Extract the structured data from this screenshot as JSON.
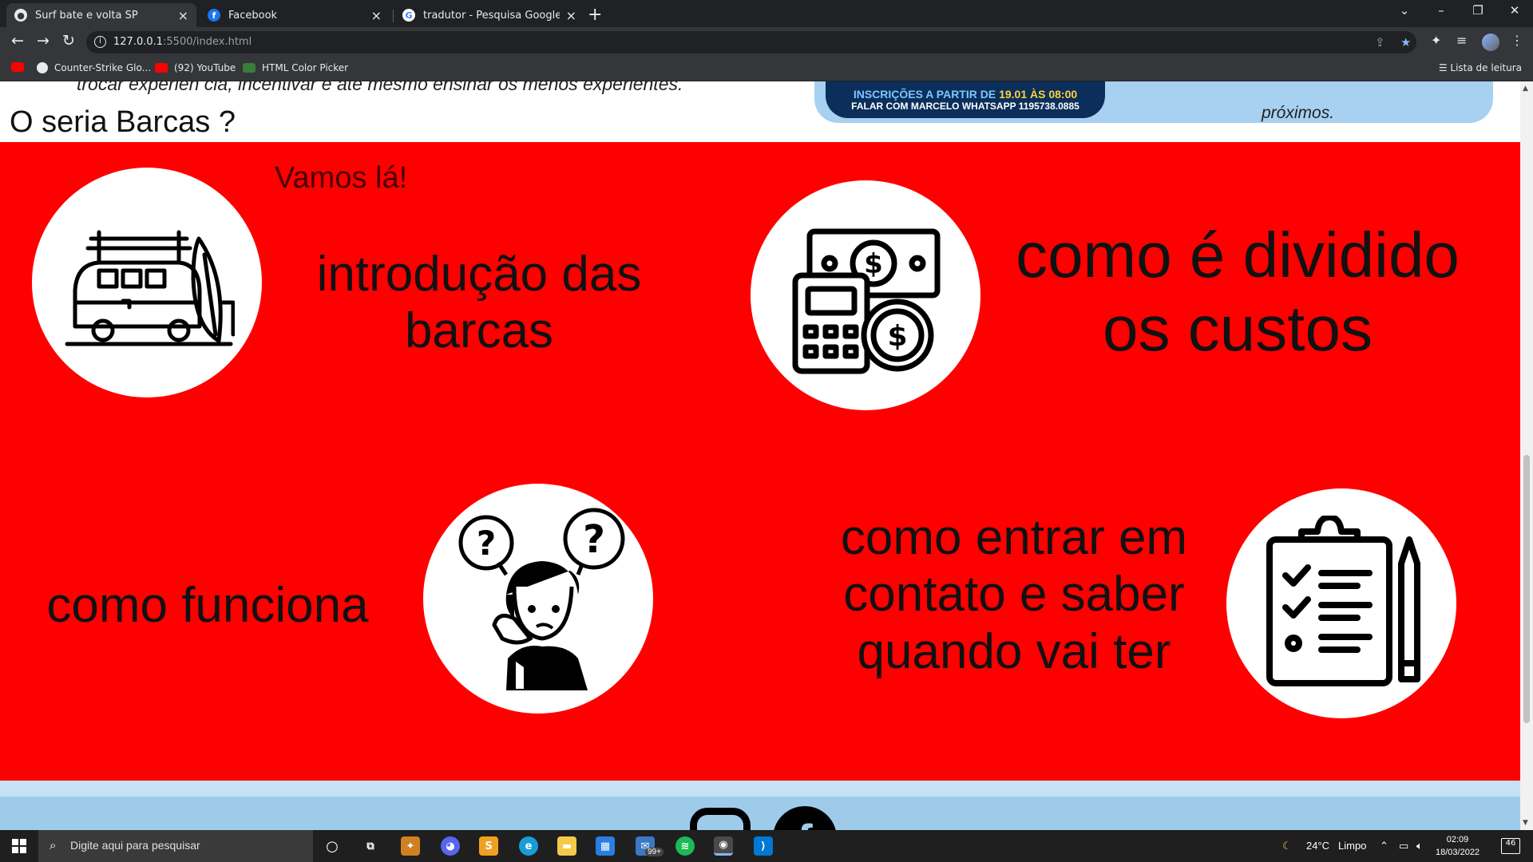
{
  "browser": {
    "tabs": [
      {
        "title": "Surf bate e volta SP",
        "active": true,
        "favicon": "globe-icon"
      },
      {
        "title": "Facebook",
        "active": false,
        "favicon": "facebook-icon"
      },
      {
        "title": "tradutor - Pesquisa Google",
        "active": false,
        "favicon": "google-icon"
      }
    ],
    "url_host": "127.0.0.1",
    "url_rest": ":5500/index.html",
    "bookmarks": [
      {
        "label": "",
        "icon": "youtube-icon"
      },
      {
        "label": "Counter-Strike Glo...",
        "icon": "steam-icon"
      },
      {
        "label": "(92) YouTube",
        "icon": "youtube-icon"
      },
      {
        "label": "HTML Color Picker",
        "icon": "color-picker-icon"
      }
    ],
    "reading_list": "Lista de leitura"
  },
  "page": {
    "prev_text": "trocar experiên cia, incentivar e até mesmo ensinar os menos experientes.",
    "poster": {
      "line1_a": "INSCRIÇÕES A PARTIR DE ",
      "line1_b": "19.01 ÀS 08:00",
      "line2": "FALAR COM MARCELO WHATSAPP 1195738.0885",
      "side_text": "próximos."
    },
    "section_title": "O seria Barcas ?",
    "vamos": "Vamos lá!",
    "cards": [
      {
        "text_lines": [
          "introdução das",
          "barcas"
        ],
        "icon": "van-surfboard-icon"
      },
      {
        "text_lines": [
          "como é dividido",
          "os custos"
        ],
        "icon": "money-calculator-icon"
      },
      {
        "text_lines": [
          "como funciona"
        ],
        "icon": "confused-person-icon"
      },
      {
        "text_lines": [
          "como entrar em",
          "contato e saber",
          "quando vai ter"
        ],
        "icon": "clipboard-checklist-icon"
      }
    ],
    "colors": {
      "section_bg": "#ff0000",
      "footer_bg": "#9ecbea"
    }
  },
  "taskbar": {
    "search_placeholder": "Digite aqui para pesquisar",
    "mail_badge": "99+",
    "weather_temp": "24°C",
    "weather_desc": "Limpo",
    "time": "02:09",
    "date": "18/03/2022",
    "notifications": "46"
  }
}
